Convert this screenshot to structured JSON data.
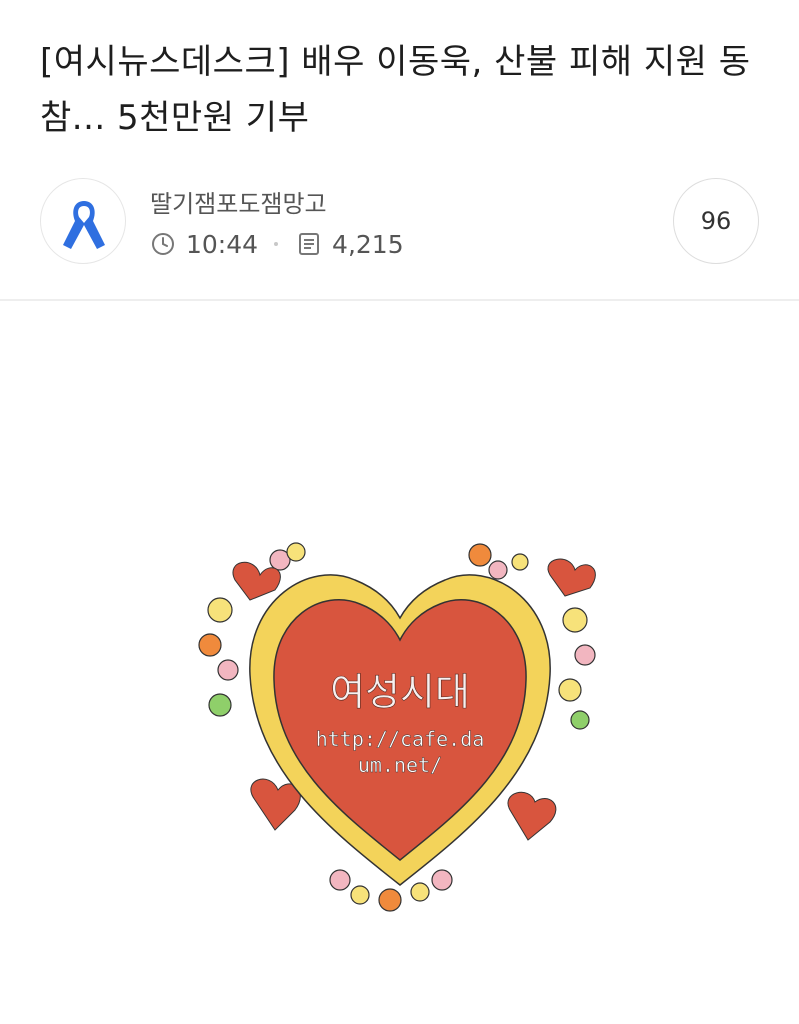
{
  "post": {
    "title": "[여시뉴스데스크] 배우 이동욱, 산불 피해 지원 동참... 5천만원 기부",
    "author": "딸기잼포도잼망고",
    "time": "10:44",
    "views": "4,215",
    "comment_count": "96"
  },
  "image": {
    "logo_text": "여성시대",
    "logo_url_line1": "http://cafe.da",
    "logo_url_line2": "um.net/"
  },
  "icons": {
    "avatar": "blue-ribbon-icon",
    "time": "clock-icon",
    "views": "document-icon"
  },
  "colors": {
    "ribbon": "#2f6fe0",
    "heart": "#d8553e",
    "heart_border": "#f3d35a"
  }
}
